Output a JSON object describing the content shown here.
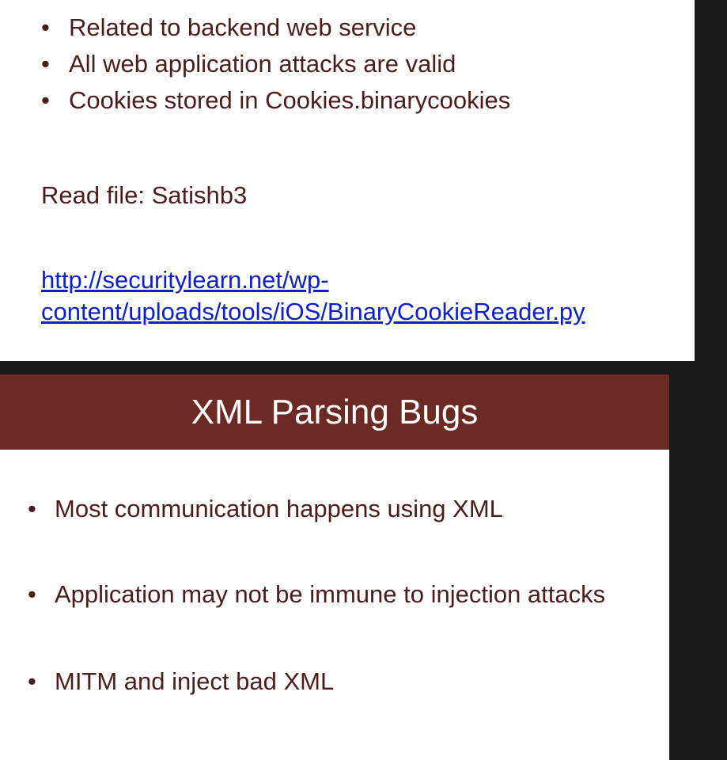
{
  "slide_top": {
    "bullets": [
      {
        "label": "Related to backend web service"
      },
      {
        "label": "All web application attacks are valid"
      },
      {
        "label": "Cookies stored in Cookies.binarycookies"
      }
    ],
    "bullet_glyph": "•",
    "read_file": "Read file: Satishb3",
    "link_url": "http://securitylearn.net/wp-content/uploads/tools/iOS/BinaryCookieReader.py",
    "link_text": "http://securitylearn.net/wp-content/uploads/tools/iOS/BinaryCookieReader.py"
  },
  "slide_bottom": {
    "title": "XML Parsing Bugs",
    "title_bar_color": "#6b2a24",
    "bullets": [
      {
        "label": "Most communication happens using XML"
      },
      {
        "label": "Application may not be immune to injection attacks"
      },
      {
        "label": "MITM and inject bad XML"
      }
    ],
    "bullet_glyph": "•"
  },
  "colors": {
    "background": "#1a1a1a",
    "text": "#4a1d1b",
    "link": "#0d1ecc"
  }
}
